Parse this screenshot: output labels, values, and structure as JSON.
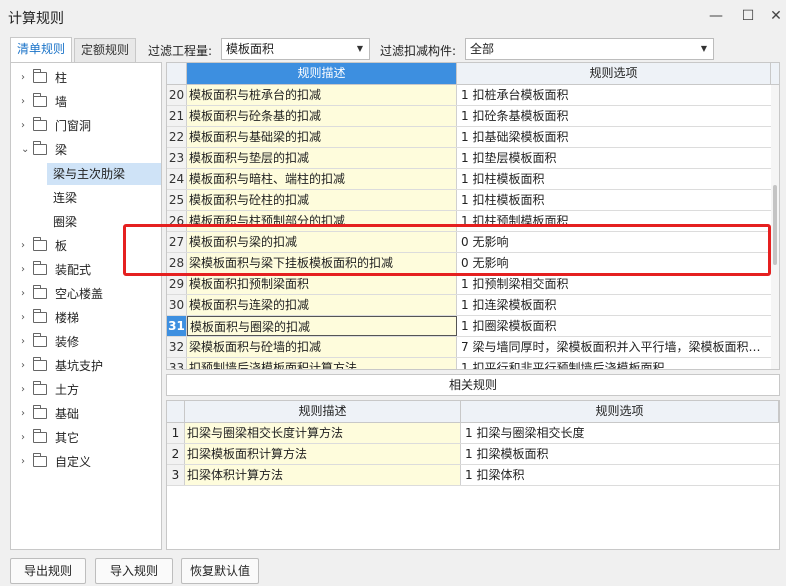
{
  "window": {
    "title": "计算规则",
    "minimize_glyph": "—",
    "maximize_glyph": "☐",
    "close_glyph": "✕"
  },
  "tabs": [
    {
      "label": "清单规则",
      "active": true
    },
    {
      "label": "定额规则",
      "active": false
    }
  ],
  "filters": {
    "quantity_label": "过滤工程量:",
    "quantity_value": "模板面积",
    "component_label": "过滤扣减构件:",
    "component_value": "全部"
  },
  "tree": {
    "items": [
      {
        "label": "柱",
        "expanded": false
      },
      {
        "label": "墙",
        "expanded": false
      },
      {
        "label": "门窗洞",
        "expanded": false
      },
      {
        "label": "梁",
        "expanded": true
      },
      {
        "label": "梁与主次肋梁",
        "child": true,
        "selected": true
      },
      {
        "label": "连梁",
        "child": true
      },
      {
        "label": "圈梁",
        "child": true
      },
      {
        "label": "板",
        "expanded": false
      },
      {
        "label": "装配式",
        "expanded": false
      },
      {
        "label": "空心楼盖",
        "expanded": false
      },
      {
        "label": "楼梯",
        "expanded": false
      },
      {
        "label": "装修",
        "expanded": false
      },
      {
        "label": "基坑支护",
        "expanded": false
      },
      {
        "label": "土方",
        "expanded": false
      },
      {
        "label": "基础",
        "expanded": false
      },
      {
        "label": "其它",
        "expanded": false
      },
      {
        "label": "自定义",
        "expanded": false
      }
    ],
    "collapsed_glyph": "›",
    "expanded_glyph": "⌄"
  },
  "rules_grid": {
    "headers": {
      "desc": "规则描述",
      "option": "规则选项"
    },
    "rows": [
      {
        "num": "20",
        "desc": "模板面积与桩承台的扣减",
        "option": "1 扣桩承台模板面积"
      },
      {
        "num": "21",
        "desc": "模板面积与砼条基的扣减",
        "option": "1 扣砼条基模板面积"
      },
      {
        "num": "22",
        "desc": "模板面积与基础梁的扣减",
        "option": "1 扣基础梁模板面积"
      },
      {
        "num": "23",
        "desc": "模板面积与垫层的扣减",
        "option": "1 扣垫层模板面积"
      },
      {
        "num": "24",
        "desc": "模板面积与暗柱、端柱的扣减",
        "option": "1 扣柱模板面积"
      },
      {
        "num": "25",
        "desc": "模板面积与砼柱的扣减",
        "option": "1 扣柱模板面积"
      },
      {
        "num": "26",
        "desc": "模板面积与柱预制部分的扣减",
        "option": "1 扣柱预制模板面积"
      },
      {
        "num": "27",
        "desc": "模板面积与梁的扣减",
        "option": "0   无影响"
      },
      {
        "num": "28",
        "desc": "梁模板面积与梁下挂板模板面积的扣减",
        "option": "0   无影响"
      },
      {
        "num": "29",
        "desc": "模板面积扣预制梁面积",
        "option": "1   扣预制梁相交面积"
      },
      {
        "num": "30",
        "desc": "模板面积与连梁的扣减",
        "option": "1 扣连梁模板面积"
      },
      {
        "num": "31",
        "desc": "模板面积与圈梁的扣减",
        "option": "1 扣圈梁模板面积",
        "current": true
      },
      {
        "num": "32",
        "desc": "梁模板面积与砼墙的扣减",
        "option": "7 梁与墙同厚时，梁模板面积并入平行墙，梁模板面积…"
      },
      {
        "num": "33",
        "desc": "扣预制墙后浇模板面积计算方法",
        "option": "1 扣平行和非平行预制墙后浇模板面积"
      }
    ]
  },
  "related": {
    "label": "相关规则"
  },
  "related_grid": {
    "headers": {
      "desc": "规则描述",
      "option": "规则选项"
    },
    "rows": [
      {
        "num": "1",
        "desc": "扣梁与圈梁相交长度计算方法",
        "option": "1 扣梁与圈梁相交长度"
      },
      {
        "num": "2",
        "desc": "扣梁模板面积计算方法",
        "option": "1   扣梁模板面积"
      },
      {
        "num": "3",
        "desc": "扣梁体积计算方法",
        "option": "1   扣梁体积"
      }
    ]
  },
  "buttons": {
    "export": "导出规则",
    "import": "导入规则",
    "reset": "恢复默认值"
  },
  "colors": {
    "accent": "#3d8fe0",
    "highlight_border": "#e52020",
    "desc_cell_bg": "#fefcdc"
  }
}
